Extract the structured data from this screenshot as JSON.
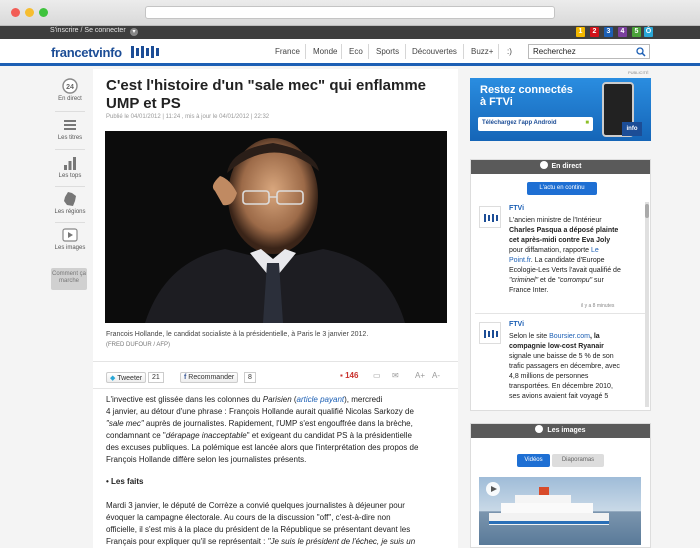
{
  "topbar": {
    "login": "S'inscrire / Se connecter"
  },
  "channels": [
    {
      "label": "1",
      "color": "#f2b700"
    },
    {
      "label": "2",
      "color": "#d1121a"
    },
    {
      "label": "3",
      "color": "#1c5fb4"
    },
    {
      "label": "4",
      "color": "#7b3f9e"
    },
    {
      "label": "5",
      "color": "#4aa23a"
    },
    {
      "label": "Ô",
      "color": "#2aa7d6"
    }
  ],
  "header": {
    "logo": "francetvinfo",
    "nav": [
      "France",
      "Monde",
      "Eco",
      "Sports",
      "Découvertes",
      "Buzz+",
      ":)"
    ],
    "search_value": "Recherchez"
  },
  "rail": [
    {
      "label": "En direct",
      "icon": "live-24-icon",
      "badge": "24"
    },
    {
      "label": "Les titres",
      "icon": "list-icon"
    },
    {
      "label": "Les tops",
      "icon": "bar-chart-icon"
    },
    {
      "label": "Les régions",
      "icon": "france-map-icon"
    },
    {
      "label": "Les images",
      "icon": "play-icon"
    }
  ],
  "rail_comment": "Comment ça marche",
  "article": {
    "title": "C'est l'histoire d'un \"sale mec\" qui enflamme UMP et PS",
    "pubdate": "Publié le 04/01/2012 | 11:24 , mis à jour le 04/01/2012 | 22:32",
    "caption": "Francois Hollande, le candidat socialiste à la présidentielle, à Paris le 3 janvier 2012.",
    "credit": "(FRED DUFOUR / AFP)",
    "share": {
      "tweet": "Tweeter",
      "tweet_count": "21",
      "fb": "Recommander",
      "fb_count": "8",
      "comments": "146",
      "font_up": "A+",
      "font_down": "A-"
    },
    "p1": {
      "a": "L'invective est glissée dans les colonnes du ",
      "b": "Parisien",
      "c": "article payant",
      "d": ", mercredi",
      "line2a": "4 janvier, au détour d'une phrase : François Hollande aurait qualifié Nicolas Sarkozy de",
      "line3a": "\"sale mec\"",
      "line3b": " auprès de journalistes. Rapidement, l'UMP s'est engouffrée dans la brèche,",
      "line4a": "condamnant ce \"",
      "line4b": "dérapage inacceptable",
      "line4c": "\" et exigeant du candidat PS à la présidentielle",
      "line5": "des excuses publiques. La polémique est lancée alors que l'interprétation des propos de",
      "line6": "François Hollande diffère selon les journalistes présents."
    },
    "section": "• Les faits",
    "p2": {
      "line1": "Mardi 3 janvier, le député de Corrèze a convié quelques journalistes à déjeuner pour",
      "line2": "évoquer la campagne électorale. Au cours de la discussion \"off\", c'est-à-dire non",
      "line3": "officielle, il s'est mis à la place du président de la République se présentant devant les",
      "line4a": "Français pour expliquer qu'il se représentait : ",
      "line4b": "\"Je suis le président de l'échec, je suis un"
    }
  },
  "ad": {
    "pub": "PUBLICITÉ",
    "title1": "Restez connectés",
    "title2": "à FTVi",
    "button": "Téléchargez l'app Android",
    "badge": "info"
  },
  "live": {
    "header": "En direct",
    "button": "L'actu en continu",
    "items": [
      {
        "source": "FTVi",
        "l1": "L'ancien ministre de l'Intérieur",
        "l2": "Charles Pasqua a déposé plainte",
        "l3": "cet après-midi contre Eva Joly",
        "l4a": "pour diffamation, rapporte ",
        "l4b": "Le",
        "l5": "Point.fr",
        "l5b": ". La candidate d'Europe",
        "l6": "Ecologie-Les Verts l'avait qualifié de",
        "l7a": "\"criminel\"",
        "l7b": " et de ",
        "l7c": "\"corrompu\"",
        "l7d": " sur",
        "l8": "France Inter.",
        "time": "il y a 8 minutes"
      },
      {
        "source": "FTVi",
        "l1a": "Selon le site ",
        "l1b": "Boursier.com",
        "l1c": ", la",
        "l2": "compagnie low-cost Ryanair",
        "l3": "signale une baisse de 5 % de son",
        "l4": "trafic passagers en décembre, avec",
        "l5": "4,8 millions de personnes",
        "l6": "transportées. En décembre 2010,",
        "l7": "ses avions avaient fait voyagé 5"
      }
    ]
  },
  "images": {
    "header": "Les images",
    "tab_videos": "Vidéos",
    "tab_photos": "Diaporamas"
  }
}
